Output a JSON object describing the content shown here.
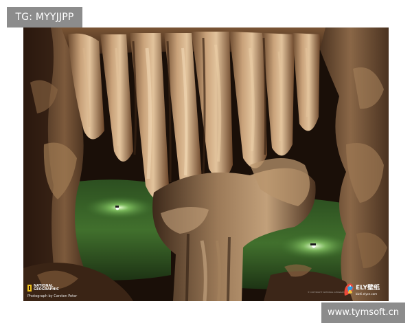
{
  "badges": {
    "top": "TG: MYYJJPP",
    "bottom": "www.tymsoft.cn"
  },
  "photo": {
    "subject": "cave with stalactite column and green underground pools",
    "logo_text_line1": "NATIONAL",
    "logo_text_line2": "GEOGRAPHIC",
    "credit": "Photograph by Carsten Peter",
    "copyright": "© COPYRIGHT NATIONAL GEOGRAPHIC",
    "site_logo_icon": "parrot-logo-icon",
    "site_logo_text": "ELY壁纸",
    "site_logo_url": "bizhi.elycn.com"
  },
  "colors": {
    "badge_bg": "#8c8c8c",
    "badge_text": "#ffffff",
    "ng_yellow": "#f1c21b",
    "water_green": "#4f8a3a"
  }
}
